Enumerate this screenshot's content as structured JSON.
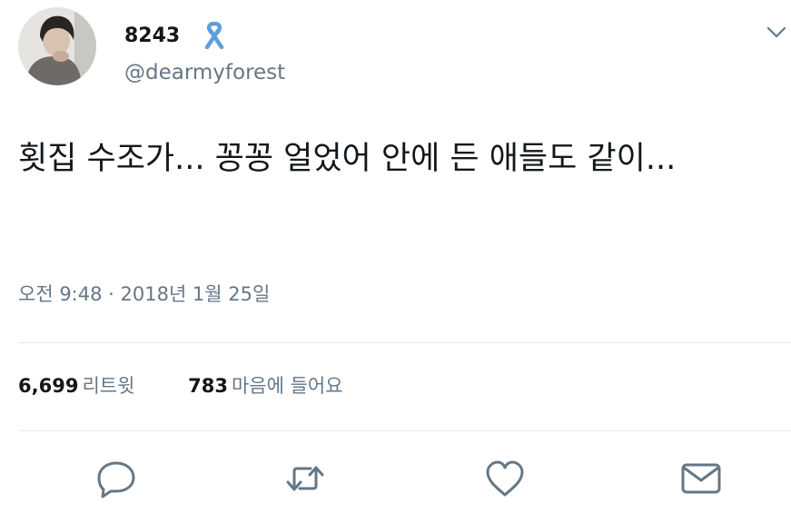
{
  "user": {
    "display_name": "8243",
    "badge_icon": "ribbon-icon",
    "handle": "@dearmyforest"
  },
  "menu_icon": "chevron-down-icon",
  "tweet": {
    "text": "횟집 수조가... 꽁꽁 얼었어 안에 든 애들도 같이...",
    "timestamp": "오전 9:48 · 2018년 1월 25일"
  },
  "stats": {
    "retweets": {
      "count": "6,699",
      "label": "리트윗"
    },
    "likes": {
      "count": "783",
      "label": "마음에 들어요"
    }
  },
  "actions": [
    {
      "icon": "reply-icon"
    },
    {
      "icon": "retweet-icon"
    },
    {
      "icon": "like-icon"
    },
    {
      "icon": "message-icon"
    }
  ],
  "colors": {
    "text_primary": "#14171a",
    "text_secondary": "#657786",
    "divider": "#e1e8ed",
    "ribbon": "#5d9fd8"
  }
}
